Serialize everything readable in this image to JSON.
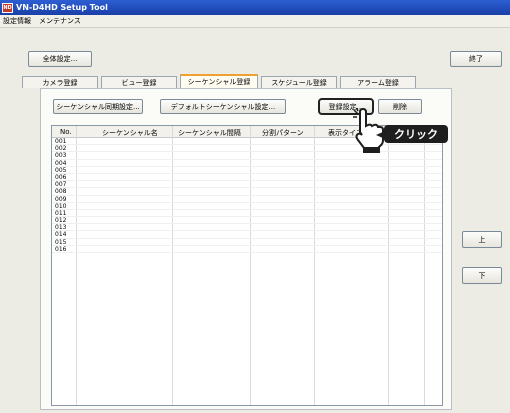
{
  "window": {
    "title": "VN-D4HD Setup Tool",
    "icon_label": "ND"
  },
  "menu": {
    "items": [
      "設定情報",
      "メンテナンス"
    ]
  },
  "toolbar": {
    "global_settings": "全体設定...",
    "exit": "終了"
  },
  "tabs": [
    {
      "label": "カメラ登録",
      "active": false
    },
    {
      "label": "ビュー登録",
      "active": false
    },
    {
      "label": "シーケンシャル登録",
      "active": true
    },
    {
      "label": "スケジュール登録",
      "active": false
    },
    {
      "label": "アラーム登録",
      "active": false
    }
  ],
  "panel_buttons": {
    "sync_settings": "シーケンシャル同期設定...",
    "default_settings": "デフォルトシーケンシャル設定...",
    "register_settings": "登録設定...",
    "delete": "削除"
  },
  "table": {
    "columns": [
      "No.",
      "シーケンシャル名",
      "シーケンシャル間隔",
      "分割パターン",
      "表示タイプ"
    ],
    "rows": [
      "001",
      "002",
      "003",
      "004",
      "005",
      "006",
      "007",
      "008",
      "009",
      "010",
      "011",
      "012",
      "013",
      "014",
      "015",
      "016"
    ]
  },
  "side_buttons": {
    "up": "上",
    "down": "下"
  },
  "annotation": {
    "click_label": "クリック"
  },
  "colors": {
    "titlebar": "#1a3fa6",
    "active_tab_accent": "#f0a030",
    "callout": "#1e1e1e"
  }
}
